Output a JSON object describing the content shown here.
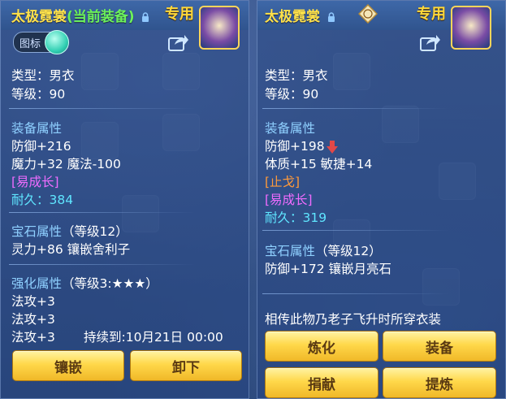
{
  "left": {
    "title": "太极霓裳",
    "title_suffix": "(当前装备)",
    "exclusive": "专用",
    "toggle_label": "图标",
    "type_line": "类型：男衣",
    "level_line": "等级：90",
    "equip_header": "装备属性",
    "attr1": "防御+216",
    "attr2": "魔力+32 魔法-100",
    "grow": "[易成长]",
    "durability_label": "耐久：",
    "durability_value": "384",
    "gem_header": "宝石属性",
    "gem_level": "（等级12）",
    "gem_attr": "灵力+86 镶嵌舍利子",
    "enh_header": "强化属性",
    "enh_level": "（等级3:★★★）",
    "enh1": "法攻+3",
    "enh2": "法攻+3",
    "enh3": "法攻+3",
    "duration": "持续到:10月21日 00:00",
    "btn_inlay": "镶嵌",
    "btn_unequip": "卸下"
  },
  "right": {
    "title": "太极霓裳",
    "exclusive": "专用",
    "type_line": "类型：男衣",
    "level_line": "等级：90",
    "equip_header": "装备属性",
    "attr1": "防御+198",
    "attr2": "体质+15 敏捷+14",
    "special1": "[止戈]",
    "grow": "[易成长]",
    "durability_label": "耐久：",
    "durability_value": "319",
    "gem_header": "宝石属性",
    "gem_level": "（等级12）",
    "gem_attr": "防御+172 镶嵌月亮石",
    "description": "相传此物乃老子飞升时所穿衣装",
    "btn_refine": "炼化",
    "btn_equip": "装备",
    "btn_donate": "捐献",
    "btn_extract": "提炼"
  },
  "colors": {
    "title": "#ffe24a",
    "current_equip": "#6cf25a",
    "section": "#8fd0ff",
    "durability": "#5fe6ff",
    "grow": "#f06cff",
    "special": "#ff9a3a",
    "button": "#ffd84a",
    "stat_down": "#e24848"
  },
  "icons": [
    "lock-icon",
    "bound-seal-icon",
    "share-icon",
    "item-robe-icon",
    "down-arrow-icon"
  ]
}
